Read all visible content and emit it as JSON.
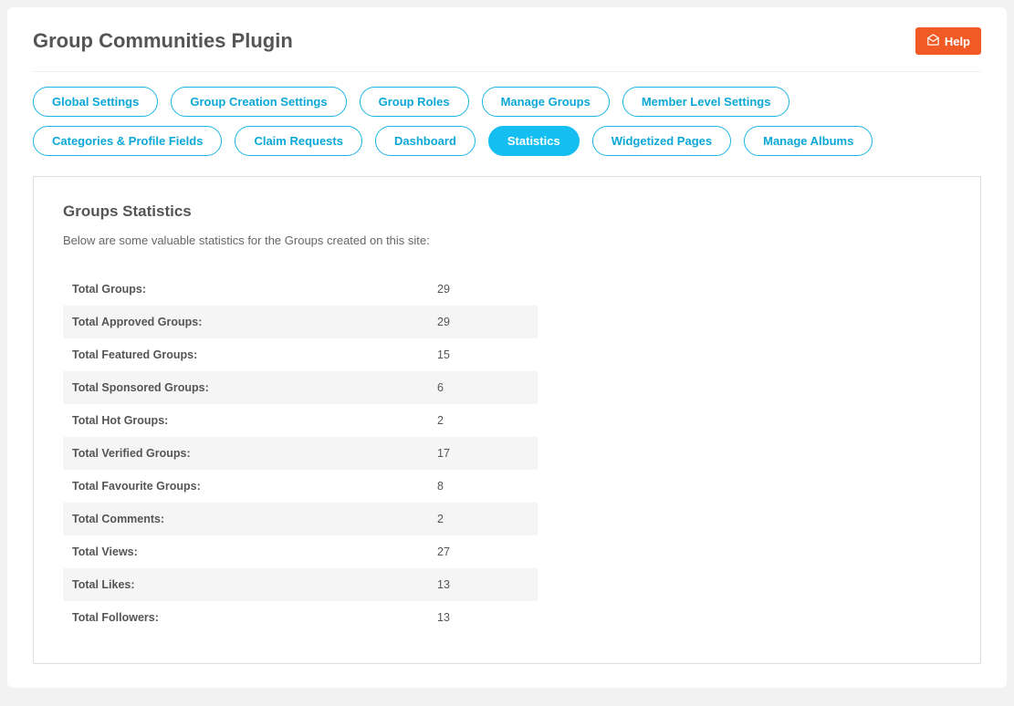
{
  "header": {
    "title": "Group Communities Plugin",
    "help_label": "Help"
  },
  "tabs": [
    {
      "label": "Global Settings",
      "active": false
    },
    {
      "label": "Group Creation Settings",
      "active": false
    },
    {
      "label": "Group Roles",
      "active": false
    },
    {
      "label": "Manage Groups",
      "active": false
    },
    {
      "label": "Member Level Settings",
      "active": false
    },
    {
      "label": "Categories & Profile Fields",
      "active": false
    },
    {
      "label": "Claim Requests",
      "active": false
    },
    {
      "label": "Dashboard",
      "active": false
    },
    {
      "label": "Statistics",
      "active": true
    },
    {
      "label": "Widgetized Pages",
      "active": false
    },
    {
      "label": "Manage Albums",
      "active": false
    }
  ],
  "content": {
    "section_title": "Groups Statistics",
    "section_desc": "Below are some valuable statistics for the Groups created on this site:",
    "stats": [
      {
        "label": "Total Groups:",
        "value": "29"
      },
      {
        "label": "Total Approved Groups:",
        "value": "29"
      },
      {
        "label": "Total Featured Groups:",
        "value": "15"
      },
      {
        "label": "Total Sponsored Groups:",
        "value": "6"
      },
      {
        "label": "Total Hot Groups:",
        "value": "2"
      },
      {
        "label": "Total Verified Groups:",
        "value": "17"
      },
      {
        "label": "Total Favourite Groups:",
        "value": "8"
      },
      {
        "label": "Total Comments:",
        "value": "2"
      },
      {
        "label": "Total Views:",
        "value": "27"
      },
      {
        "label": "Total Likes:",
        "value": "13"
      },
      {
        "label": "Total Followers:",
        "value": "13"
      }
    ]
  }
}
